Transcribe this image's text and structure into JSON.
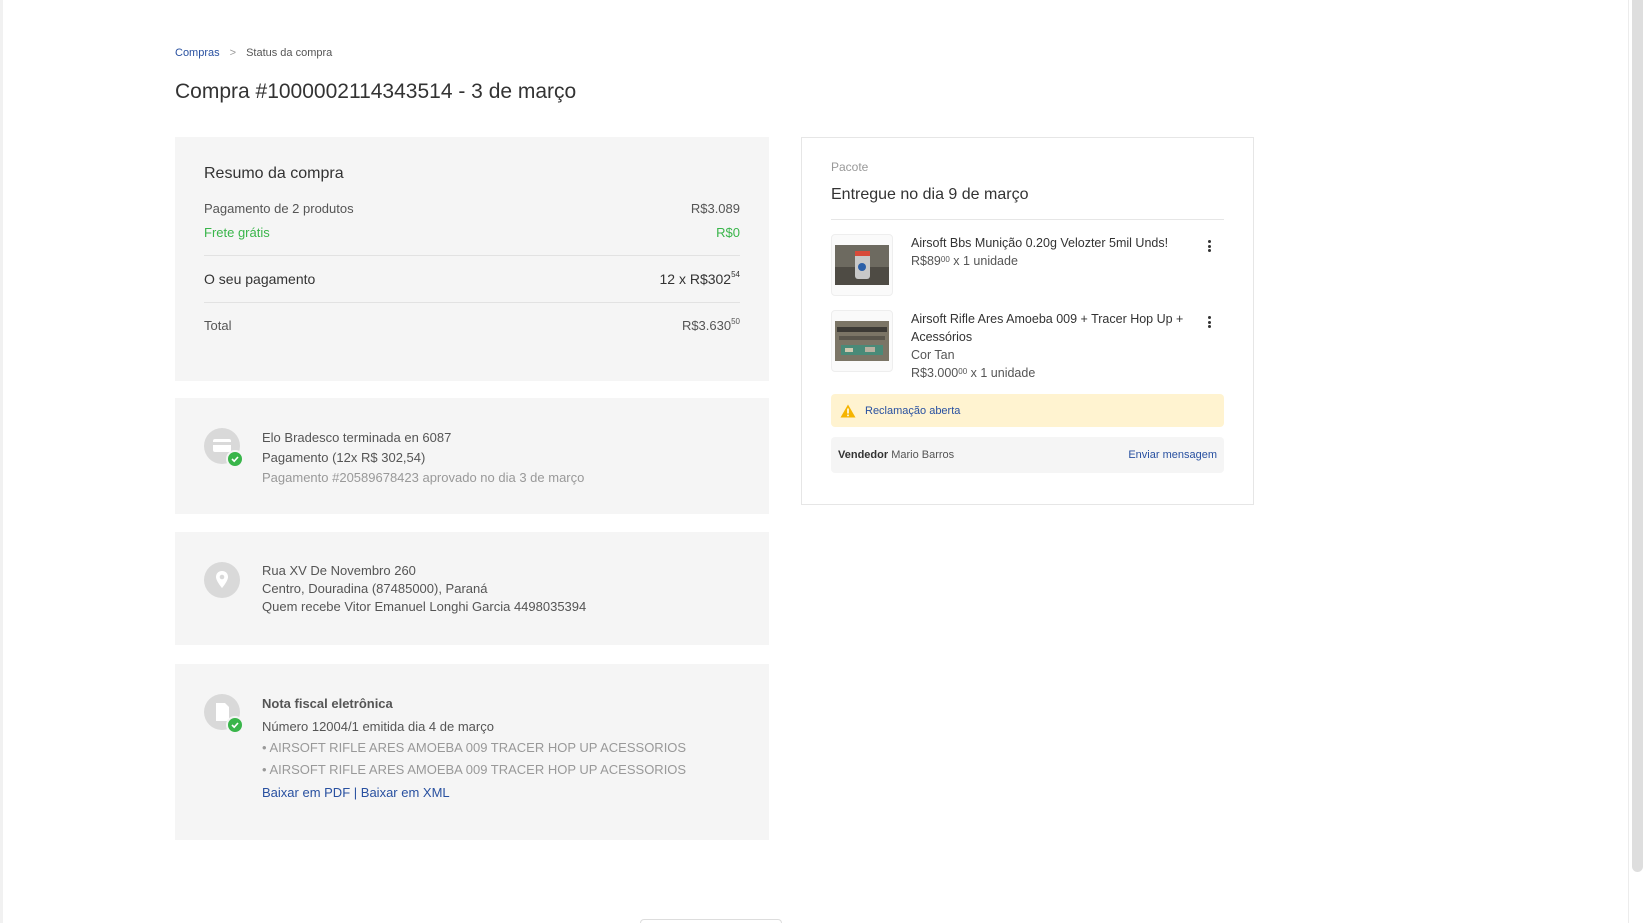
{
  "breadcrumb": {
    "parent": "Compras",
    "separator": ">",
    "current": "Status da compra"
  },
  "title": "Compra #1000002114343514 - 3 de março",
  "summary": {
    "title": "Resumo da compra",
    "products_label": "Pagamento de 2 produtos",
    "products_value": "R$3.089",
    "shipping_label": "Frete grátis",
    "shipping_value": "R$0",
    "payment_label": "O seu pagamento",
    "payment_main": "12 x R$302",
    "payment_cents": "54",
    "total_label": "Total",
    "total_main": "R$3.630",
    "total_cents": "50"
  },
  "payment": {
    "card": "Elo Bradesco terminada en 6087",
    "installments": "Pagamento (12x R$ 302,54)",
    "approval": "Pagamento #20589678423 aprovado no dia 3 de março"
  },
  "address": {
    "street": "Rua XV De Novembro 260",
    "city": "Centro, Douradina (87485000), Paraná",
    "receiver": "Quem recebe Vitor Emanuel Longhi Garcia 4498035394"
  },
  "invoice": {
    "title": "Nota fiscal eletrônica",
    "number": "Número 12004/1 emitida dia 4 de março",
    "items": [
      "AIRSOFT RIFLE ARES AMOEBA 009 TRACER HOP UP ACESSORIOS",
      "AIRSOFT RIFLE ARES AMOEBA 009 TRACER HOP UP ACESSORIOS"
    ],
    "bullet": "•",
    "pdf_link": "Baixar em PDF",
    "link_sep": "|",
    "xml_link": "Baixar em XML"
  },
  "package": {
    "label": "Pacote",
    "status": "Entregue no dia 9 de março",
    "products": [
      {
        "title": "Airsoft Bbs Munição 0.20g Velozter 5mil Unds!",
        "variant": "",
        "price_main": "R$89",
        "price_cents": "00",
        "qty": "x 1 unidade"
      },
      {
        "title": "Airsoft Rifle Ares Amoeba 009 + Tracer Hop Up + Acessórios",
        "variant": "Cor Tan",
        "price_main": "R$3.000",
        "price_cents": "00",
        "qty": "x 1 unidade"
      }
    ],
    "claim": "Reclamação aberta",
    "seller_label": "Vendedor",
    "seller_name": "Mario Barros",
    "send_message": "Enviar mensagem"
  },
  "colors": {
    "link": "#2850a0",
    "success": "#39b54a",
    "warning_bg": "#fff3d0",
    "card_bg": "#f5f5f5"
  },
  "icons": [
    "credit-card-icon",
    "check-icon",
    "location-pin-icon",
    "document-icon",
    "warning-icon",
    "kebab-menu-icon"
  ]
}
